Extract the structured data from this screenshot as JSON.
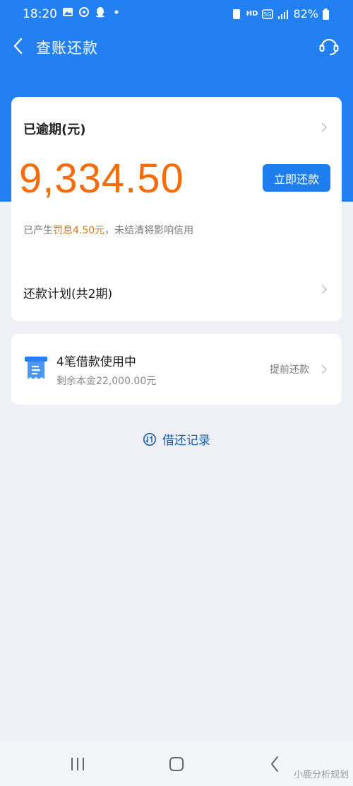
{
  "status_bar": {
    "time": "18:20",
    "battery": "82%",
    "network_label": "HD"
  },
  "nav": {
    "title": "查账还款"
  },
  "overdue_card": {
    "label": "已逾期(元)",
    "amount": "9,334.50",
    "repay_button": "立即还款",
    "penalty_prefix": "已产生",
    "penalty_highlight": "罚息4.50元",
    "penalty_suffix": "，未结清将影响信用",
    "plan_label": "还款计划(共2期)"
  },
  "loan_card": {
    "title": "4笔借款使用中",
    "subtitle": "剩余本金22,000.00元",
    "prepay_label": "提前还款"
  },
  "records": {
    "label": "借还记录"
  },
  "watermark": "小鹿分析规划",
  "colors": {
    "header": "#2280f3",
    "accent": "#1e7ef0",
    "amount": "#f56c0b",
    "penalty": "#d4781c"
  }
}
